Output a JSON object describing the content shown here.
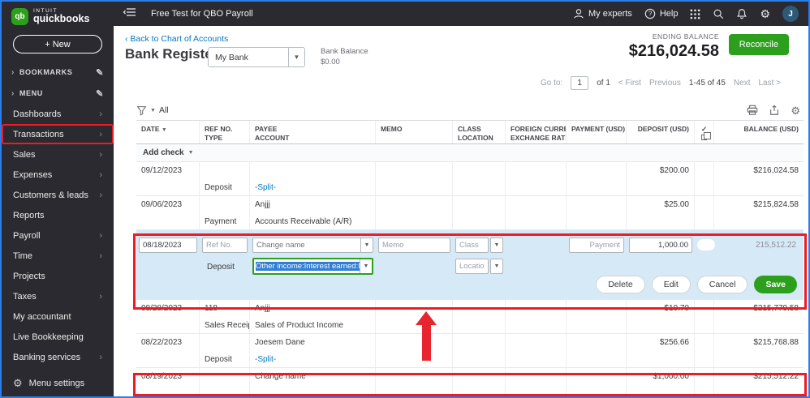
{
  "topbar": {
    "title": "Free Test for QBO Payroll",
    "my_experts": "My experts",
    "help": "Help",
    "avatar_initial": "J"
  },
  "sidebar": {
    "brand_top": "INTUIT",
    "brand": "quickbooks",
    "logo_text": "qb",
    "new_button": "+ New",
    "bookmarks_label": "BOOKMARKS",
    "menu_label": "MENU",
    "items": [
      {
        "label": "Dashboards"
      },
      {
        "label": "Transactions"
      },
      {
        "label": "Sales"
      },
      {
        "label": "Expenses"
      },
      {
        "label": "Customers & leads"
      },
      {
        "label": "Reports"
      },
      {
        "label": "Payroll"
      },
      {
        "label": "Time"
      },
      {
        "label": "Projects"
      },
      {
        "label": "Taxes"
      },
      {
        "label": "My accountant"
      },
      {
        "label": "Live Bookkeeping"
      },
      {
        "label": "Banking services"
      }
    ],
    "menu_settings": "Menu settings"
  },
  "header": {
    "back_link": "Back to Chart of Accounts",
    "title": "Bank Register",
    "account_selector": "My Bank",
    "bank_balance_label": "Bank Balance",
    "bank_balance_value": "$0.00",
    "ending_balance_label": "ENDING BALANCE",
    "ending_balance_value": "$216,024.58",
    "reconcile_button": "Reconcile"
  },
  "pagination": {
    "go_to_label": "Go to:",
    "page_value": "1",
    "of_label": "of 1",
    "first": "< First",
    "previous": "Previous",
    "range": "1-45 of 45",
    "next": "Next",
    "last": "Last >"
  },
  "toolbar": {
    "filter_label": "All"
  },
  "table": {
    "headers": {
      "date": "DATE",
      "ref": "REF NO.",
      "type": "TYPE",
      "payee": "PAYEE",
      "account": "ACCOUNT",
      "memo": "MEMO",
      "class": "CLASS",
      "location": "LOCATION",
      "foreign_currency": "FOREIGN CURRENCY",
      "exchange_rate": "EXCHANGE RATE",
      "payment": "PAYMENT (USD)",
      "deposit": "DEPOSIT (USD)",
      "check": "✓",
      "balance": "BALANCE (USD)"
    },
    "add_row_label": "Add check",
    "rows": [
      {
        "date": "09/12/2023",
        "ref": "",
        "type": "Deposit",
        "payee": "",
        "account": "-Split-",
        "payment": "",
        "deposit": "$200.00",
        "balance": "$216,024.58"
      },
      {
        "date": "09/06/2023",
        "ref": "",
        "type": "Payment",
        "payee": "Anjjj",
        "account": "Accounts Receivable (A/R)",
        "payment": "",
        "deposit": "$25.00",
        "balance": "$215,824.58"
      },
      {
        "date": "08/28/2023",
        "ref": "118",
        "type": "Sales Receipt",
        "payee": "Anjjj",
        "account": "Sales of Product Income",
        "payment": "",
        "deposit": "$10.70",
        "balance": "$215,779.58"
      },
      {
        "date": "08/22/2023",
        "ref": "",
        "type": "Deposit",
        "payee": "Joesem Dane",
        "account": "-Split-",
        "payment": "",
        "deposit": "$256.66",
        "balance": "$215,768.88"
      },
      {
        "date": "08/19/2023",
        "ref": "",
        "type": "",
        "payee": "Change name",
        "account": "",
        "payment": "",
        "deposit": "$1,000.00",
        "balance": "$215,512.22"
      }
    ]
  },
  "edit_row": {
    "date_value": "08/18/2023",
    "ref_placeholder": "Ref No.",
    "payee_value": "Change name",
    "memo_placeholder": "Memo",
    "class_placeholder": "Class",
    "payment_placeholder": "Payment",
    "deposit_value": "1,000.00",
    "balance": "215,512.22",
    "type": "Deposit",
    "account_value": "Other income:Interest earned:Inte",
    "location_placeholder": "Location",
    "delete_button": "Delete",
    "edit_button": "Edit",
    "cancel_button": "Cancel",
    "save_button": "Save"
  },
  "colors": {
    "brand_green": "#2ca01c",
    "link_blue": "#0077c5",
    "edit_row_bg": "#d6e9f7",
    "annotation_red": "#ed1c24",
    "topbar_dark": "#2a2a30"
  }
}
